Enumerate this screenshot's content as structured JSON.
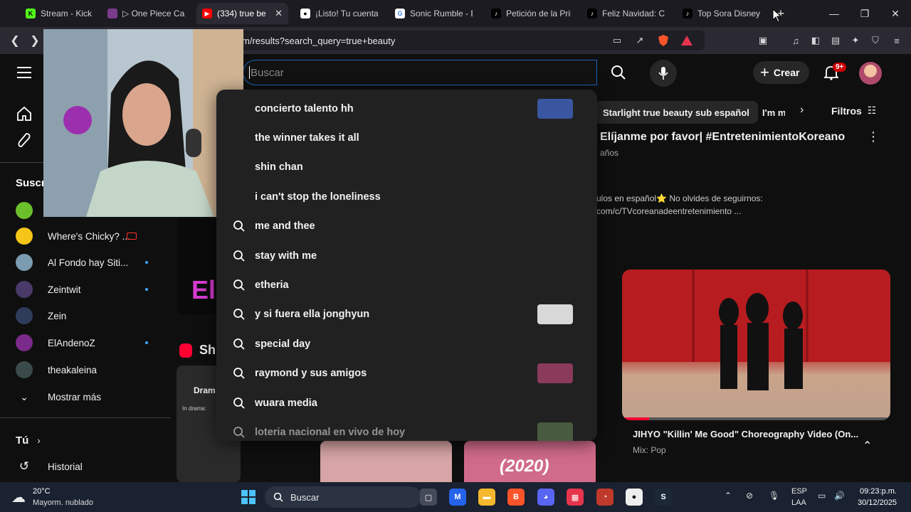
{
  "browser": {
    "tabs": [
      {
        "label": "Stream - Kick Das",
        "favicon_color": "#53fc18"
      },
      {
        "label": "▷ One Piece Cap",
        "favicon_color": "#7a3b8c"
      },
      {
        "label": "(334) true be",
        "favicon_color": "#ff0000"
      },
      {
        "label": "¡Listo! Tu cuenta",
        "favicon_color": "#ffffff"
      },
      {
        "label": "Sonic Rumble - B",
        "favicon_color": "#4285f4"
      },
      {
        "label": "Petición de la Prin",
        "favicon_color": "#010101"
      },
      {
        "label": "Feliz Navidad: Cel",
        "favicon_color": "#010101"
      },
      {
        "label": "Top Sora Disney P",
        "favicon_color": "#010101"
      }
    ],
    "active_tab_index": 2,
    "new_tab_symbol": "+",
    "url": "m/results?search_query=true+beauty"
  },
  "youtube": {
    "search": {
      "placeholder": "Buscar"
    },
    "create_label": "Crear",
    "notification_badge": "9+",
    "filter_label": "Filtros",
    "chips": [
      "Starlight true beauty sub español",
      "I'm m"
    ],
    "suggestions": [
      {
        "text": "concierto talento hh",
        "has_thumb": true
      },
      {
        "text": "the winner takes it all",
        "has_thumb": false
      },
      {
        "text": "shin chan",
        "has_thumb": false
      },
      {
        "text": "i can't stop the loneliness",
        "has_thumb": false
      },
      {
        "text": "me and thee",
        "has_thumb": false
      },
      {
        "text": "stay with me",
        "has_thumb": false
      },
      {
        "text": "etheria",
        "has_thumb": false
      },
      {
        "text": "y si fuera ella jonghyun",
        "has_thumb": true
      },
      {
        "text": "special day",
        "has_thumb": false
      },
      {
        "text": "raymond y sus amigos",
        "has_thumb": true
      },
      {
        "text": "wuara media",
        "has_thumb": false
      },
      {
        "text": "loteria nacional en vivo de hoy",
        "has_thumb": true
      }
    ],
    "result": {
      "title": "Elíjanme por favor| #EntretenimientoKoreano",
      "meta": "años",
      "desc_line1": "ulos en español⭐ No olvides de seguirnos:",
      "desc_line2": "com/c/TVcoreanadeentretenimiento ..."
    },
    "mix": {
      "title": "JIHYO \"Killin' Me Good\" Choreography Video (On...",
      "subtitle": "Mix: Pop",
      "progress": 0.1
    },
    "shorts_label": "Sh",
    "shorts_card_label": "Dram",
    "shorts_card_tag": "In drama:",
    "shorts_year": "(2020)",
    "large_letters": "El"
  },
  "sidebar": {
    "subscriptions_title": "Suscr",
    "subscriptions": [
      {
        "name": "",
        "color": "#6bbf2c"
      },
      {
        "name": "Where's Chicky? ...",
        "color": "#f5c518",
        "live": true
      },
      {
        "name": "Al Fondo hay Siti...",
        "color": "#7a9bb0",
        "dot": true
      },
      {
        "name": "Zeintwit",
        "color": "#4a3a6a",
        "dot": true
      },
      {
        "name": "Zein",
        "color": "#2e3c5a",
        "dot": false
      },
      {
        "name": "ElAndenoZ",
        "color": "#7a2a8a",
        "dot": true
      },
      {
        "name": "theakaleina",
        "color": "#3a4a4a",
        "dot": false
      }
    ],
    "show_more": "Mostrar más",
    "you_label": "Tú",
    "history_label": "Historial"
  },
  "taskbar": {
    "weather_temp": "20°C",
    "weather_desc": "Mayorm. nublado",
    "search_label": "Buscar",
    "lang_top": "ESP",
    "lang_bottom": "LAA",
    "time": "09:23:p.m.",
    "date": "30/12/2025"
  }
}
